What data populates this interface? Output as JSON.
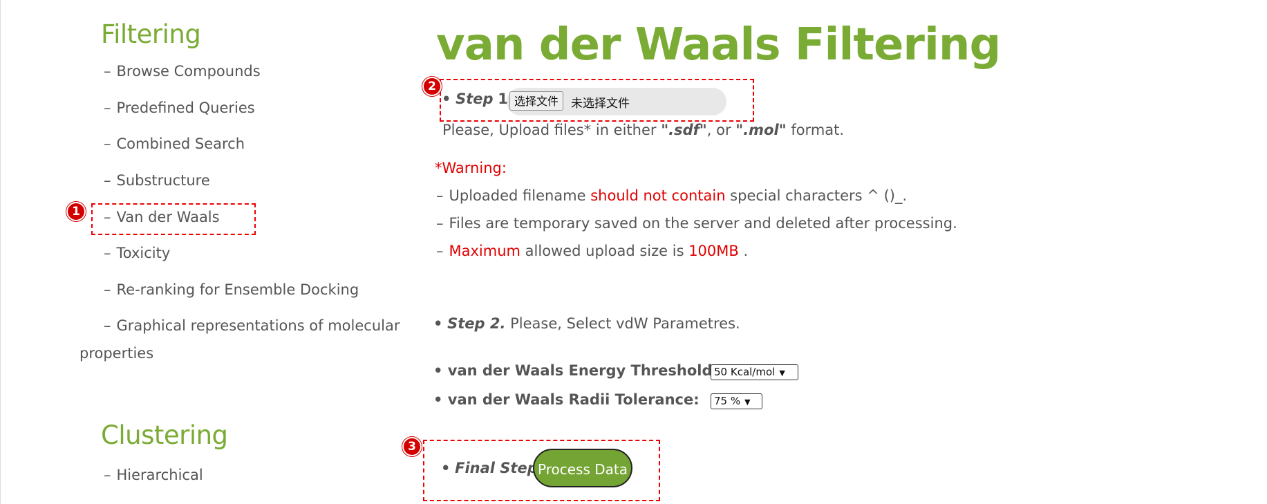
{
  "sidebar": {
    "filtering_title": "Filtering",
    "items": [
      {
        "dash": "–",
        "label": "Browse Compounds"
      },
      {
        "dash": "–",
        "label": "Predefined Queries"
      },
      {
        "dash": "–",
        "label": "Combined Search"
      },
      {
        "dash": "–",
        "label": "Substructure"
      },
      {
        "dash": "–",
        "label": "Van der Waals"
      },
      {
        "dash": "–",
        "label": "Toxicity"
      },
      {
        "dash": "–",
        "label": "Re-ranking for Ensemble Docking"
      },
      {
        "dash": "–",
        "label": "Graphical representations of molecular"
      },
      {
        "dash": "",
        "label": "properties"
      }
    ],
    "clustering_title": "Clustering",
    "clustering_items": [
      {
        "dash": "–",
        "label": "Hierarchical"
      }
    ]
  },
  "main": {
    "title": "van der Waals Filtering",
    "step1": {
      "bullet": "•",
      "label_em": "Step",
      "label_num": "1.",
      "file_button": "选择文件",
      "file_status": "未选择文件"
    },
    "upload_hint": {
      "prefix": "Please, Upload files",
      "star": "*",
      "middle": " in either ",
      "fmt1": "\".sdf\"",
      "sep": ", or ",
      "fmt2": "\".mol\"",
      "suffix": " format."
    },
    "warning": {
      "title": "*Warning:",
      "line1": {
        "dash": "–",
        "a": "Uploaded filename ",
        "red": "should not contain",
        "b": " special characters ^ ()_."
      },
      "line2": {
        "dash": "–",
        "text": "Files are temporary saved on the server and deleted after processing."
      },
      "line3": {
        "dash": "–",
        "red1": "Maximum",
        "a": " allowed upload size is ",
        "red2": "100MB",
        "b": " ."
      }
    },
    "step2": {
      "bullet": "•",
      "label_em": "Step 2.",
      "text": " Please, Select vdW Parametres."
    },
    "energy": {
      "bullet": "•",
      "label": "van der Waals Energy Threshold:",
      "value": "50 Kcal/mol"
    },
    "radii": {
      "bullet": "•",
      "label": "van der Waals Radii Tolerance:",
      "value": "75 %"
    },
    "final": {
      "bullet": "•",
      "label_em": "Final Step.",
      "button": "Process Data"
    }
  },
  "annotations": {
    "m1": "1",
    "m2": "2",
    "m3": "3"
  },
  "colors": {
    "accent_green": "#7aab34",
    "warning_red": "#e00000",
    "button_green": "#74a434"
  }
}
